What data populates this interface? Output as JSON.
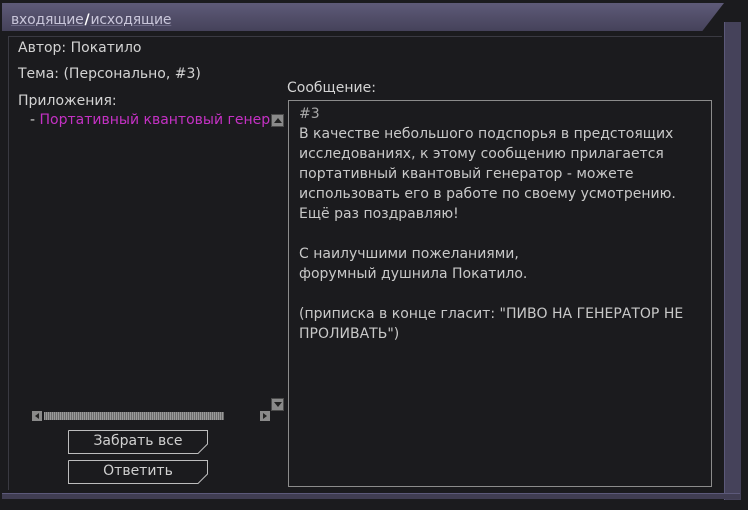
{
  "tabs": {
    "inbox": "входящие",
    "separator": "/",
    "outbox": "исходящие"
  },
  "author": "Автор: Покатило",
  "subject": "Тема: (Персонально, #3)",
  "attachments": {
    "label": "Приложения:",
    "items": [
      {
        "dash": "-",
        "name": "Портативный квантовый генератор"
      }
    ]
  },
  "buttons": {
    "take_all": "Забрать все",
    "reply": "Ответить"
  },
  "message": {
    "label": "Сообщение:",
    "lines": [
      "#3",
      "В качестве небольшого подспорья в предстоящих",
      "исследованиях, к этому сообщению прилагается",
      "портативный квантовый генератор - можете",
      "использовать его в работе по своему усмотрению.",
      "Ещё раз поздравляю!",
      "",
      "С наилучшими пожеланиями,",
      "форумный душнила Покатило.",
      "",
      "(приписка в конце гласит: \"ПИВО НА ГЕНЕРАТОР НЕ",
      "ПРОЛИВАТЬ\")"
    ]
  },
  "colors": {
    "attachment_link": "#c431c4",
    "titlebar": "#5e5a78"
  }
}
